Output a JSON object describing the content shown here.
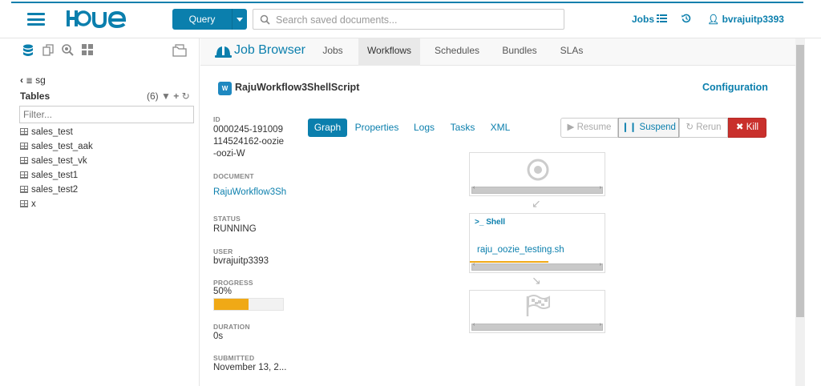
{
  "header": {
    "query_label": "Query",
    "search_placeholder": "Search saved documents...",
    "jobs_label": "Jobs",
    "user_label": "bvrajuitp3393",
    "logo_text": "HUE"
  },
  "left_panel": {
    "database": "sg",
    "tables_label": "Tables",
    "tables_count": "(6)",
    "filter_placeholder": "Filter...",
    "tables": [
      "sales_test",
      "sales_test_aak",
      "sales_test_vk",
      "sales_test1",
      "sales_test2",
      "x"
    ]
  },
  "main": {
    "title": "Job Browser",
    "tabs": [
      "Jobs",
      "Workflows",
      "Schedules",
      "Bundles",
      "SLAs"
    ],
    "active_tab": "Workflows",
    "workflow_icon_text": "W",
    "workflow_name": "RajuWorkflow3ShellScript",
    "configuration_label": "Configuration",
    "properties": {
      "id_label": "ID",
      "id_value_lines": [
        "0000245-191009",
        "114524162-oozie",
        "-oozi-W"
      ],
      "document_label": "DOCUMENT",
      "document_value": "RajuWorkflow3Sh",
      "status_label": "STATUS",
      "status_value": "RUNNING",
      "user_label": "USER",
      "user_value": "bvrajuitp3393",
      "progress_label": "PROGRESS",
      "progress_value": "50%",
      "progress_fraction": 0.5,
      "duration_label": "DURATION",
      "duration_value": "0s",
      "submitted_label": "SUBMITTED",
      "submitted_value": "November 13, 2..."
    },
    "detail_tabs": [
      "Graph",
      "Properties",
      "Logs",
      "Tasks",
      "XML"
    ],
    "active_detail_tab": "Graph",
    "actions": {
      "resume": "Resume",
      "suspend": "Suspend",
      "rerun": "Rerun",
      "kill": "Kill"
    },
    "graph": {
      "shell_label": "Shell",
      "shell_script": "raju_oozie_testing.sh"
    }
  },
  "colors": {
    "brand": "#0B7FAD",
    "progress": "#f0a916",
    "kill": "#c9302c"
  }
}
